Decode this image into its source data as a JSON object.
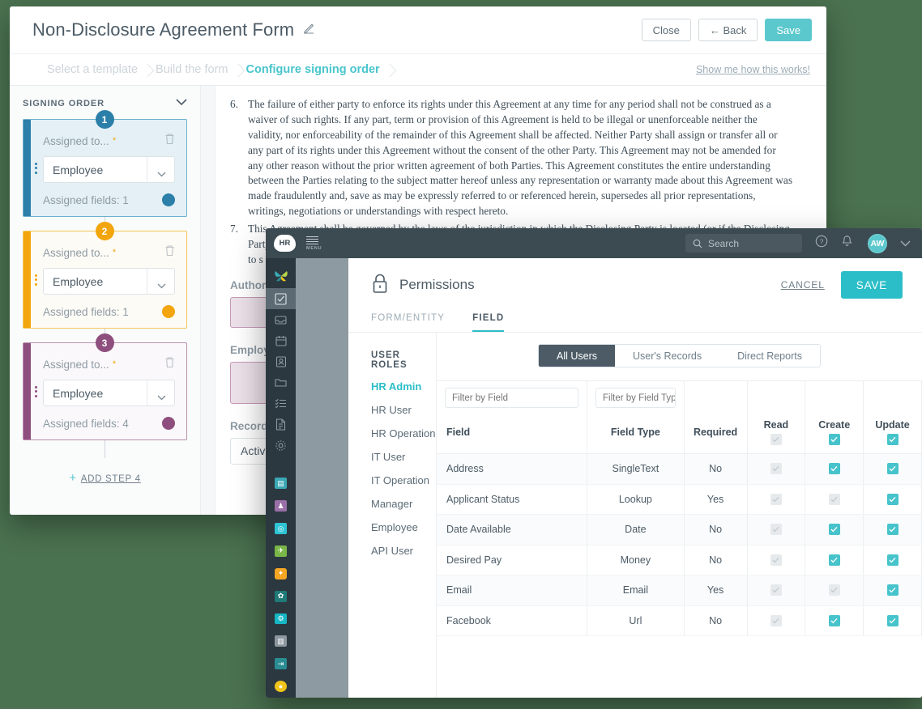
{
  "theme": {
    "page_bg": "#4a7150",
    "accent_teal": "#2bbec8",
    "dark_slate": "#3c4a52",
    "step1": "#2b7fa8",
    "step2": "#f2a50c",
    "step3": "#8e4f7e"
  },
  "form_window": {
    "title": "Non-Disclosure Agreement Form",
    "edit_icon": "pencil-icon",
    "buttons": {
      "close": "Close",
      "back": "← Back",
      "save": "Save"
    },
    "breadcrumbs": [
      {
        "label": "Select a template",
        "active": false
      },
      {
        "label": "Build the form",
        "active": false
      },
      {
        "label": "Configure signing order",
        "active": true
      }
    ],
    "help_link": "Show me how this works!",
    "signing_order": {
      "header": "SIGNING ORDER",
      "collapse_icon": "chevron-down-icon",
      "steps": [
        {
          "number": "1",
          "assigned_label": "Assigned to...",
          "required": "*",
          "value": "Employee",
          "fields_label": "Assigned fields: 1",
          "color": "#2b7fa8",
          "bg": "#e4f0f6"
        },
        {
          "number": "2",
          "assigned_label": "Assigned to...",
          "required": "*",
          "value": "Employee",
          "fields_label": "Assigned fields: 1",
          "color": "#f2a50c",
          "bg": "#fdfbf6"
        },
        {
          "number": "3",
          "assigned_label": "Assigned to...",
          "required": "*",
          "value": "Employee",
          "fields_label": "Assigned fields: 4",
          "color": "#8e4f7e",
          "bg": "#faf8fa"
        }
      ],
      "add_step": "ADD STEP 4",
      "add_icon": "plus-icon"
    },
    "document": {
      "clauses": [
        "The failure of either party to enforce its rights under this Agreement at any time for any period shall not be construed as a waiver of such rights. If any part, term or provision of this Agreement is held to be illegal or unenforceable neither the validity, nor enforceability of the remainder of this Agreement shall be affected. Neither Party shall assign or transfer all or any part of its rights under this Agreement without the consent of the other Party. This Agreement may not be amended for any other reason without the prior written agreement of both Parties. This Agreement constitutes the entire understanding between the Parties relating to the subject matter hereof unless any representation or warranty made about this Agreement was made fraudulently and, save as may be expressly referred to or referenced herein, supersedes all prior representations, writings, negotiations or understandings with respect hereto.",
        "This Agreement shall be governed by the laws of the jurisdiction in which the Disclosing Party is located (or if the Disclosing Party is based in more than one country, the country in which its headquarters are located) (the Territory) and the parties agree to s"
      ],
      "fields": [
        {
          "label": "Authorize",
          "type": "signature"
        },
        {
          "label": "Employee",
          "type": "signature"
        },
        {
          "label": "Record St",
          "type": "select",
          "value": "Active"
        }
      ]
    }
  },
  "hr_window": {
    "topbar": {
      "logo": "HR",
      "menu_label": "MENU",
      "menu_icon": "hamburger-icon",
      "search_placeholder": "Search",
      "search_icon": "search-icon",
      "help_icon": "help-circle-icon",
      "bell_icon": "bell-icon",
      "avatar_initials": "AW",
      "chevron_icon": "chevron-down-icon"
    },
    "rail": {
      "logo_icon": "butterfly-logo-icon",
      "nav_icons": [
        "checkbox-task-icon",
        "inbox-icon",
        "calendar-icon",
        "contact-card-icon",
        "folder-icon",
        "checklist-icon",
        "document-icon",
        "gear-icon"
      ],
      "app_icons": [
        {
          "name": "database-app-icon",
          "color": "#3aa9b5"
        },
        {
          "name": "person-app-icon",
          "color": "#9b6fa8"
        },
        {
          "name": "clock-app-icon",
          "color": "#2ec4d4"
        },
        {
          "name": "chart-app-icon",
          "color": "#7ab648"
        },
        {
          "name": "badge-app-icon",
          "color": "#f5a623"
        },
        {
          "name": "gear-app-icon",
          "color": "#1f7a78"
        },
        {
          "name": "settings-app-icon",
          "color": "#16b7c4"
        },
        {
          "name": "report-app-icon",
          "color": "#8c97a0"
        },
        {
          "name": "exit-app-icon",
          "color": "#2a8d93"
        },
        {
          "name": "coin-app-icon",
          "color": "#f0c419"
        }
      ]
    },
    "panel": {
      "lock_icon": "lock-icon",
      "title": "Permissions",
      "cancel": "CANCEL",
      "save": "SAVE",
      "tabs": [
        {
          "label": "FORM/ENTITY",
          "active": false
        },
        {
          "label": "FIELD",
          "active": true
        }
      ],
      "roles_header": "USER ROLES",
      "roles": [
        {
          "label": "HR Admin",
          "active": true
        },
        {
          "label": "HR User",
          "active": false
        },
        {
          "label": "HR Operation",
          "active": false
        },
        {
          "label": "IT User",
          "active": false
        },
        {
          "label": "IT Operation",
          "active": false
        },
        {
          "label": "Manager",
          "active": false
        },
        {
          "label": "Employee",
          "active": false
        },
        {
          "label": "API User",
          "active": false
        }
      ],
      "scope_tabs": [
        {
          "label": "All Users",
          "active": true
        },
        {
          "label": "User's Records",
          "active": false
        },
        {
          "label": "Direct Reports",
          "active": false
        }
      ],
      "filters": {
        "field_placeholder": "Filter by Field",
        "field_type_placeholder": "Filter by Field Type"
      },
      "table": {
        "columns": [
          "Field",
          "Field Type",
          "Required",
          "Read",
          "Create",
          "Update"
        ],
        "header_checkboxes": {
          "read": "off",
          "create": "on",
          "update": "on"
        },
        "rows": [
          {
            "field": "Address",
            "field_type": "SingleText",
            "required": "No",
            "read": "off",
            "create": "on",
            "update": "on"
          },
          {
            "field": "Applicant Status",
            "field_type": "Lookup",
            "required": "Yes",
            "read": "off",
            "create": "off",
            "update": "on"
          },
          {
            "field": "Date Available",
            "field_type": "Date",
            "required": "No",
            "read": "off",
            "create": "on",
            "update": "on"
          },
          {
            "field": "Desired Pay",
            "field_type": "Money",
            "required": "No",
            "read": "off",
            "create": "on",
            "update": "on"
          },
          {
            "field": "Email",
            "field_type": "Email",
            "required": "Yes",
            "read": "off",
            "create": "off",
            "update": "on"
          },
          {
            "field": "Facebook",
            "field_type": "Url",
            "required": "No",
            "read": "off",
            "create": "on",
            "update": "on"
          }
        ]
      }
    }
  }
}
